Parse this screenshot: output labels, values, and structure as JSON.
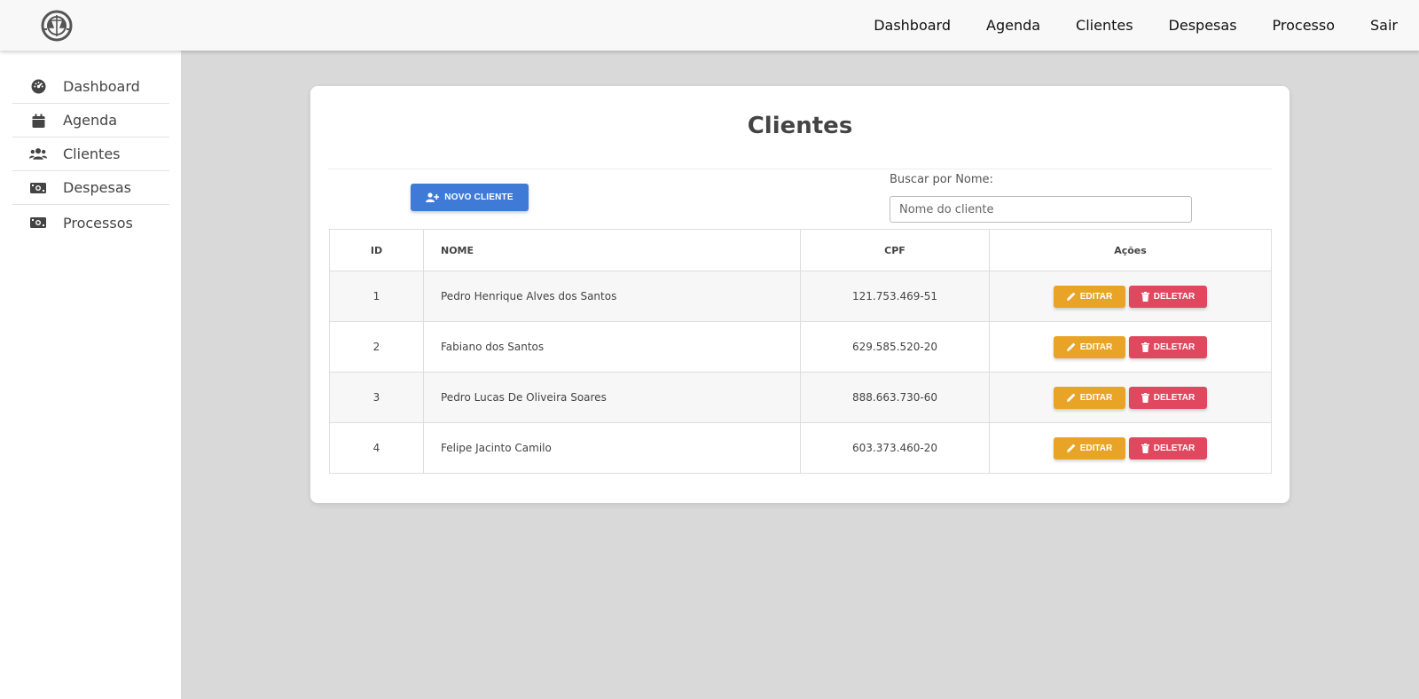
{
  "topnav": {
    "items": [
      "Dashboard",
      "Agenda",
      "Clientes",
      "Despesas",
      "Processo",
      "Sair"
    ]
  },
  "sidebar": {
    "items": [
      {
        "label": "Dashboard",
        "icon": "gauge-icon"
      },
      {
        "label": "Agenda",
        "icon": "calendar-icon"
      },
      {
        "label": "Clientes",
        "icon": "users-icon"
      },
      {
        "label": "Despesas",
        "icon": "money-bill-icon"
      },
      {
        "label": "Processos",
        "icon": "money-bill-icon"
      }
    ]
  },
  "page": {
    "title": "Clientes",
    "new_button": "NOVO CLIENTE",
    "search_label": "Buscar por Nome:",
    "search_placeholder": "Nome do cliente"
  },
  "table": {
    "headers": [
      "ID",
      "NOME",
      "CPF",
      "Ações"
    ],
    "rows": [
      {
        "id": "1",
        "nome": "Pedro Henrique Alves dos Santos",
        "cpf": "121.753.469-51"
      },
      {
        "id": "2",
        "nome": "Fabiano dos Santos",
        "cpf": "629.585.520-20"
      },
      {
        "id": "3",
        "nome": "Pedro Lucas De Oliveira Soares",
        "cpf": "888.663.730-60"
      },
      {
        "id": "4",
        "nome": "Felipe Jacinto Camilo",
        "cpf": "603.373.460-20"
      }
    ],
    "edit_label": "EDITAR",
    "delete_label": "DELETAR"
  },
  "colors": {
    "primary": "#3f7bd6",
    "edit": "#e9a427",
    "delete": "#e0485f",
    "background": "#d9d9d9"
  }
}
